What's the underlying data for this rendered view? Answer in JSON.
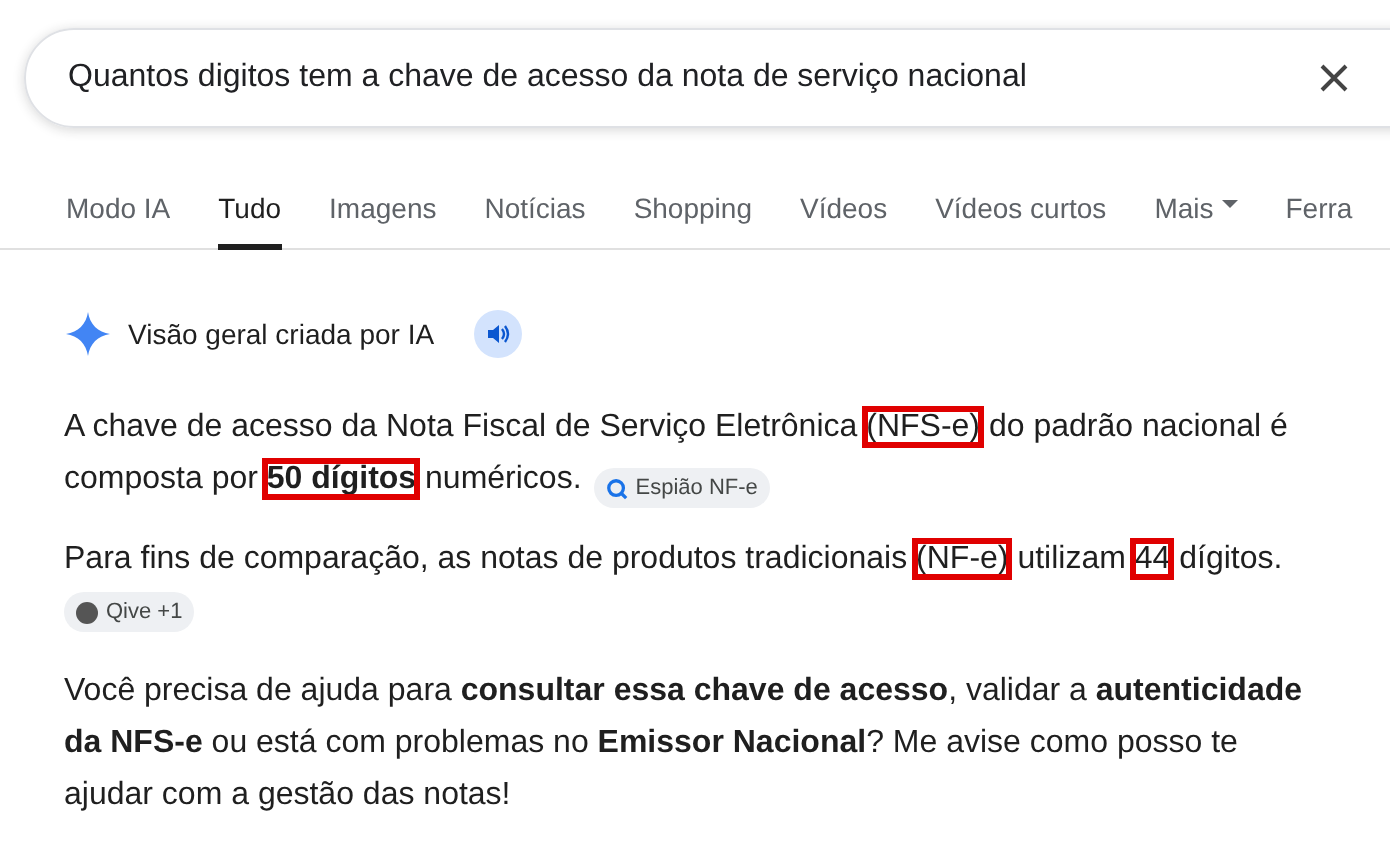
{
  "search": {
    "value": "Quantos digitos tem a chave de acesso da nota de serviço nacional"
  },
  "tabs": [
    {
      "label": "Modo IA",
      "selected": false,
      "kind": "tab"
    },
    {
      "label": "Tudo",
      "selected": true,
      "kind": "tab"
    },
    {
      "label": "Imagens",
      "selected": false,
      "kind": "tab"
    },
    {
      "label": "Notícias",
      "selected": false,
      "kind": "tab"
    },
    {
      "label": "Shopping",
      "selected": false,
      "kind": "tab"
    },
    {
      "label": "Vídeos",
      "selected": false,
      "kind": "tab"
    },
    {
      "label": "Vídeos curtos",
      "selected": false,
      "kind": "tab"
    },
    {
      "label": "Mais",
      "selected": false,
      "kind": "menu"
    },
    {
      "label": "Ferra",
      "selected": false,
      "kind": "tab"
    }
  ],
  "overview": {
    "title": "Visão geral criada por IA",
    "paragraphs": [
      {
        "parts": [
          {
            "text": "A chave de acesso da Nota Fiscal de Serviço Eletrônica ",
            "boxed": false
          },
          {
            "text": "(NFS-e)",
            "boxed": true
          },
          {
            "text": " do padrão nacional é composta por ",
            "boxed": false
          },
          {
            "text": "**50 dígitos**",
            "boxed": true
          },
          {
            "text": " numéricos.",
            "boxed": false
          }
        ],
        "source": {
          "label": "Espião NF-e",
          "kind": "search"
        }
      },
      {
        "parts": [
          {
            "text": "Para fins de comparação, as notas de produtos tradicionais ",
            "boxed": false
          },
          {
            "text": "(NF-e)",
            "boxed": true
          },
          {
            "text": " utilizam ",
            "boxed": false
          },
          {
            "text": "44",
            "boxed": true
          },
          {
            "text": " dígitos.",
            "boxed": false
          }
        ],
        "source": {
          "label": "Qive +1",
          "kind": "dark"
        }
      },
      {
        "parts": [
          {
            "text": "Você precisa de ajuda para **consultar essa chave de acesso**, validar a **autenticidade da NFS-e** ou está com problemas no **Emissor Nacional**? Me avise como posso te ajudar com a gestão das notas!",
            "boxed": false
          }
        ]
      }
    ]
  }
}
